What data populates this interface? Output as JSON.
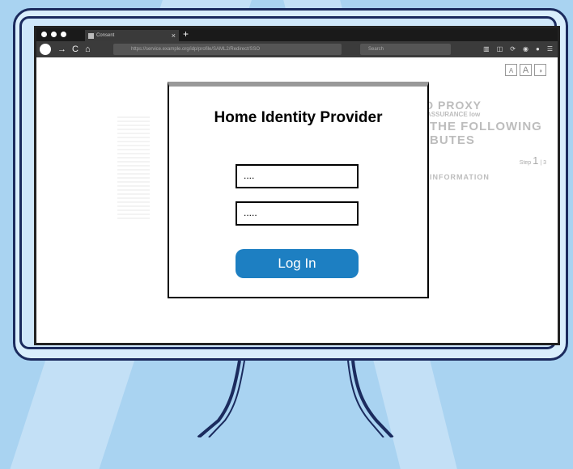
{
  "browser": {
    "tab_title": "Consent",
    "tab_close": "×",
    "new_tab": "+",
    "url": "https://service.example.org/idp/profile/SAML2/Redirect/SSO",
    "search_placeholder": "Search",
    "nav": {
      "back": "→",
      "reload": "C",
      "home": "⌂"
    },
    "toolbar_icons": [
      "library-icon",
      "sidebar-icon",
      "sync-icon",
      "account-icon",
      "extension-icon",
      "menu-icon"
    ]
  },
  "page": {
    "bg_heading_1": "D PROXY",
    "bg_subheading": "ASSURANCE low",
    "bg_heading_2": "THE FOLLOWING",
    "bg_heading_3": "BUTES",
    "bg_info": "INFORMATION",
    "step_label": "Step",
    "step_current": "1",
    "step_total": "| 3",
    "accessibility": [
      "A",
      "A",
      "◑"
    ]
  },
  "login": {
    "title": "Home Identity Provider",
    "username_value": "....",
    "password_value": ".....",
    "login_button": "Log In"
  },
  "colors": {
    "background": "#a9d3f1",
    "frame": "#1b2b5e",
    "button": "#1d7fc2"
  }
}
